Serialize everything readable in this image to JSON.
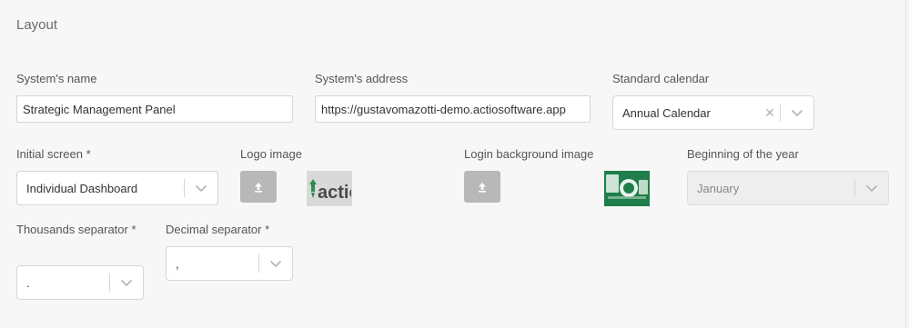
{
  "section": {
    "title": "Layout"
  },
  "fields": {
    "system_name": {
      "label": "System's name",
      "value": "Strategic Management Panel"
    },
    "system_address": {
      "label": "System's address",
      "value": "https://gustavomazotti-demo.actiosoftware.app"
    },
    "standard_calendar": {
      "label": "Standard calendar",
      "value": "Annual Calendar"
    },
    "initial_screen": {
      "label": "Initial screen *",
      "value": "Individual Dashboard"
    },
    "logo_image": {
      "label": "Logo image",
      "logo_text": "actio"
    },
    "login_background": {
      "label": "Login background image"
    },
    "beginning_of_year": {
      "label": "Beginning of the year",
      "value": "January"
    },
    "thousands_separator": {
      "label": "Thousands separator *",
      "value": "."
    },
    "decimal_separator": {
      "label": "Decimal separator *",
      "value": ","
    }
  },
  "icons": {
    "upload": "upload-icon",
    "clear": "clear-icon",
    "chevron": "chevron-down-icon"
  },
  "colors": {
    "brand_green": "#1e7d48",
    "upload_button": "#b8b8b8"
  }
}
